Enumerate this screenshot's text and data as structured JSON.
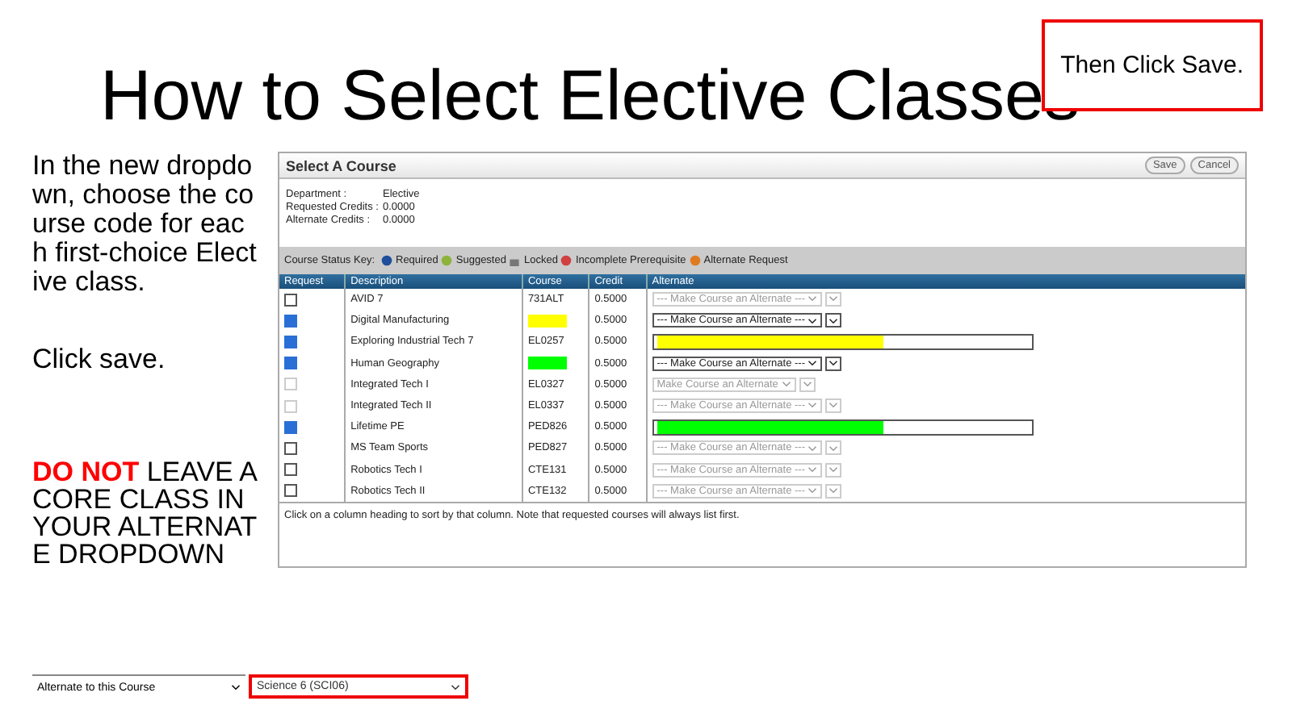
{
  "title": "How to Select Elective Classes",
  "callout": "Then Click Save.",
  "instructions": [
    "In the new dropdown, choose the course code for each first-choice Elective class.",
    "Click save."
  ],
  "warning": {
    "emphasis": "DO NOT",
    "text": "LEAVE A CORE CLASS IN YOUR ALTERNATE DROPDOWN"
  },
  "dialog": {
    "title": "Select A Course",
    "buttons": [
      "Save",
      "Cancel"
    ],
    "info": [
      {
        "label": "Department :",
        "value": "Elective"
      },
      {
        "label": "Requested Credits :",
        "value": "0.0000"
      },
      {
        "label": "Alternate Credits :",
        "value": "0.0000"
      }
    ],
    "status_key": {
      "label": "Course Status Key:",
      "items": [
        {
          "kind": "required",
          "label": "Required"
        },
        {
          "kind": "suggested",
          "label": "Suggested"
        },
        {
          "kind": "locked",
          "label": "Locked"
        },
        {
          "kind": "incomplete",
          "label": "Incomplete Prerequisite"
        },
        {
          "kind": "alternate",
          "label": "Alternate Request"
        }
      ]
    },
    "columns": [
      "Request",
      "Description",
      "Course",
      "Credit",
      "Alternate"
    ],
    "rows": [
      {
        "checked": false,
        "disabled": false,
        "description": "AVID 7",
        "course": "731ALT",
        "credit": "0.5000",
        "alternate": {
          "kind": "select",
          "text": "--- Make Course an Alternate ---",
          "disabled": true
        }
      },
      {
        "checked": true,
        "disabled": false,
        "description": "Digital Manufacturing",
        "course_mark": {
          "color": "#ffff00"
        },
        "credit": "0.5000",
        "alternate": {
          "kind": "select",
          "text": "--- Make Course an Alternate ---",
          "disabled": false
        }
      },
      {
        "checked": true,
        "disabled": false,
        "description": "Exploring Industrial Tech 7",
        "course": "EL0257",
        "credit": "0.5000",
        "alternate": {
          "kind": "marked",
          "color": "#ffff00"
        }
      },
      {
        "checked": true,
        "disabled": false,
        "description": "Human Geography",
        "course_mark": {
          "color": "#00ff00"
        },
        "credit": "0.5000",
        "alternate": {
          "kind": "select",
          "text": "--- Make Course an Alternate ---",
          "disabled": false
        }
      },
      {
        "checked": false,
        "disabled": true,
        "description": "Integrated Tech I",
        "course": "EL0327",
        "credit": "0.5000",
        "alternate": {
          "kind": "select",
          "text": "Make Course an Alternate",
          "disabled": true
        }
      },
      {
        "checked": false,
        "disabled": true,
        "description": "Integrated Tech II",
        "course": "EL0337",
        "credit": "0.5000",
        "alternate": {
          "kind": "select",
          "text": "--- Make Course an Alternate ---",
          "disabled": true
        }
      },
      {
        "checked": true,
        "disabled": false,
        "description": "Lifetime PE",
        "course": "PED826",
        "credit": "0.5000",
        "alternate": {
          "kind": "marked",
          "color": "#00ff00"
        }
      },
      {
        "checked": false,
        "disabled": false,
        "description": "MS Team Sports",
        "course": "PED827",
        "credit": "0.5000",
        "alternate": {
          "kind": "select",
          "text": "--- Make Course an Alternate ---",
          "disabled": true
        }
      },
      {
        "checked": false,
        "disabled": false,
        "description": "Robotics Tech I",
        "course": "CTE131",
        "credit": "0.5000",
        "alternate": {
          "kind": "select",
          "text": "--- Make Course an Alternate ---",
          "disabled": true
        }
      },
      {
        "checked": false,
        "disabled": false,
        "description": "Robotics Tech II",
        "course": "CTE132",
        "credit": "0.5000",
        "alternate": {
          "kind": "select",
          "text": "--- Make Course an Alternate ---",
          "disabled": true
        }
      }
    ],
    "note": "Click on a column heading to sort by that column. Note that requested courses will always list first."
  },
  "example": {
    "selects": [
      {
        "text": "Alternate to this Course",
        "crossed": false
      },
      {
        "text": "Science 6 (SCI06)",
        "crossed": true
      }
    ]
  }
}
